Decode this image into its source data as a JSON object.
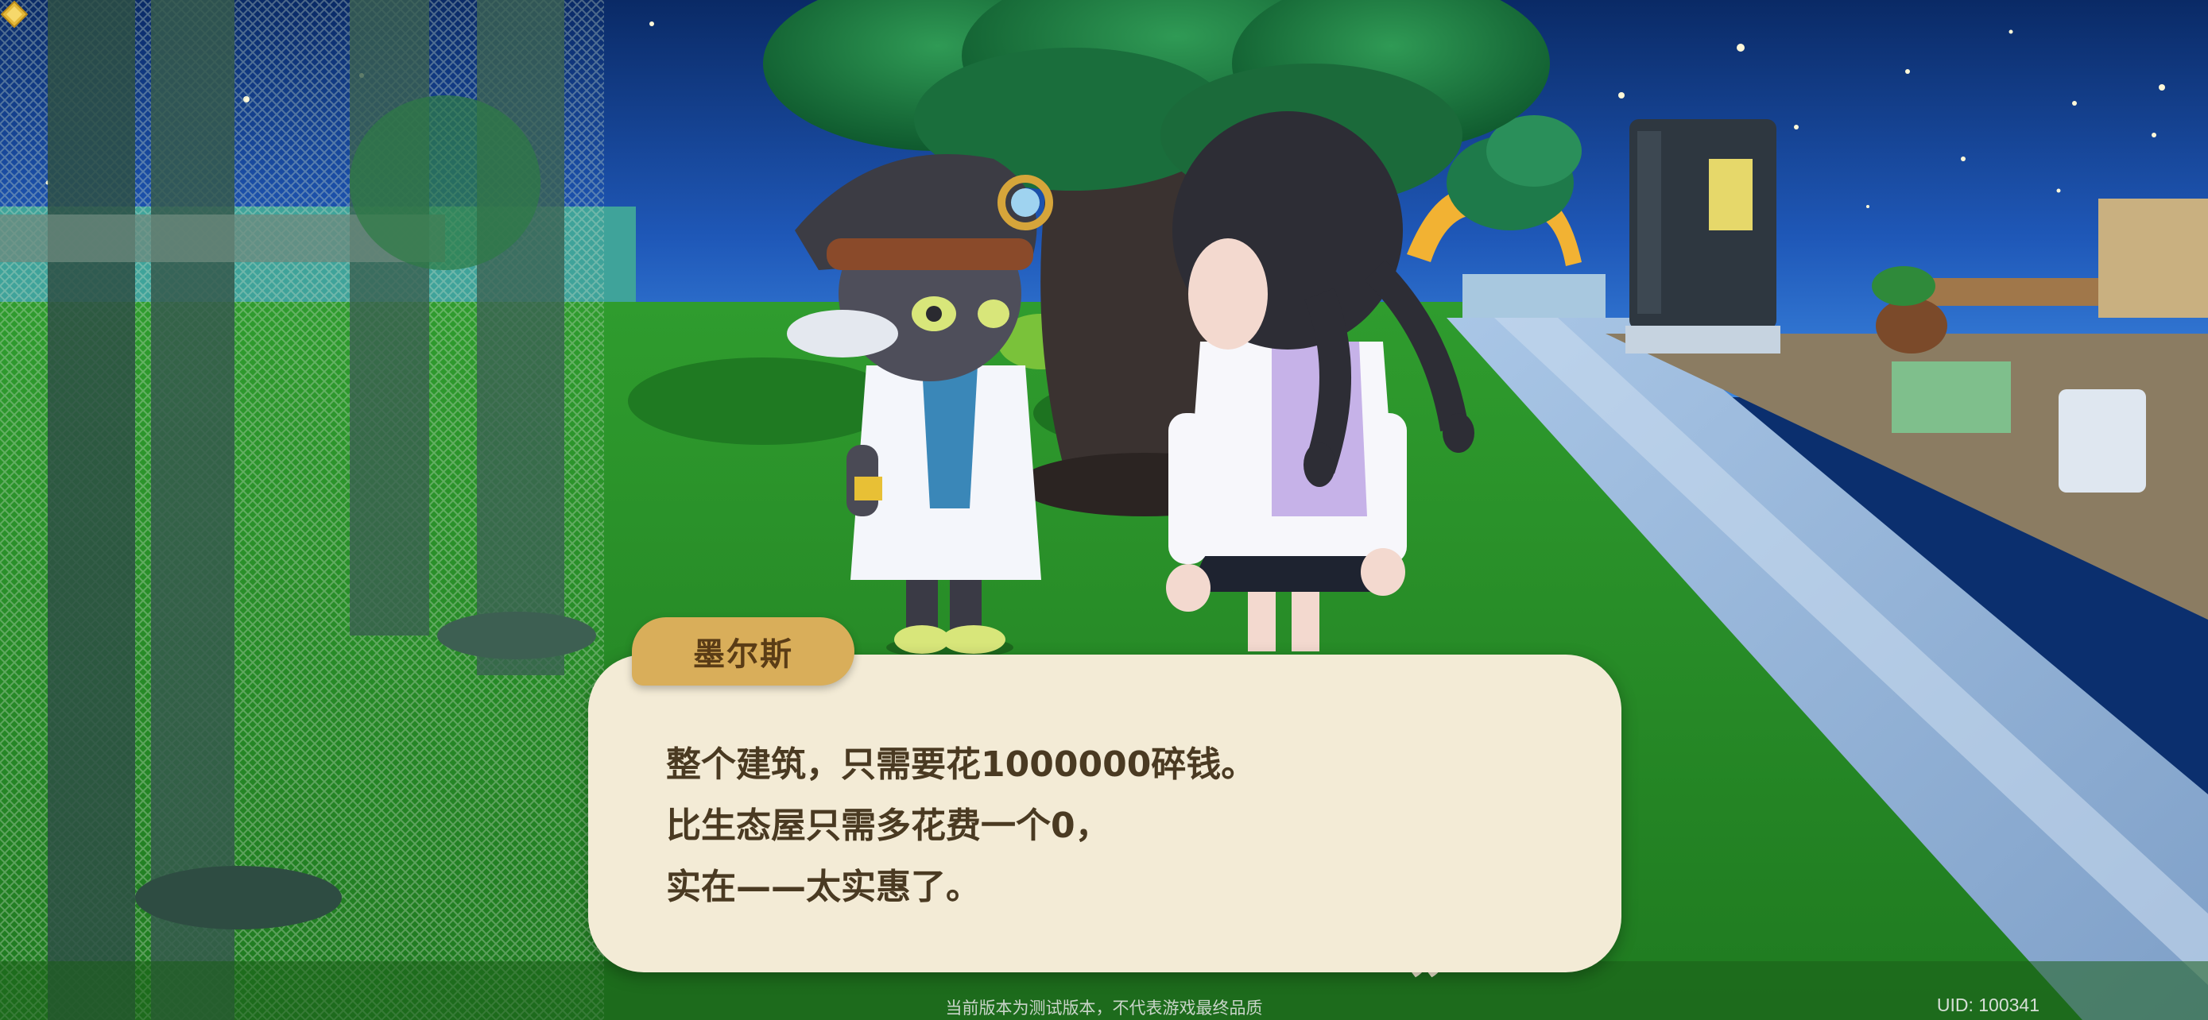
{
  "dialogue": {
    "speaker": "墨尔斯",
    "lines": [
      "整个建筑，只需要花1000000碎钱。",
      "比生态屋只需多花费一个0，",
      "实在——太实惠了。"
    ],
    "continue_icon": "diamond-continue-icon",
    "quote_icon": "closing-quote-icon"
  },
  "footer": {
    "notice": "当前版本为测试版本，不代表游戏最终品质",
    "uid": "UID: 100341"
  },
  "colors": {
    "sky_top": "#0a2a66",
    "sky_bottom": "#2e6ed0",
    "grass": "#2f8f2a",
    "name_tag": "#d9ae5a",
    "dialog_bg": "#f3ebd6",
    "dialog_text": "#4a3a22"
  }
}
